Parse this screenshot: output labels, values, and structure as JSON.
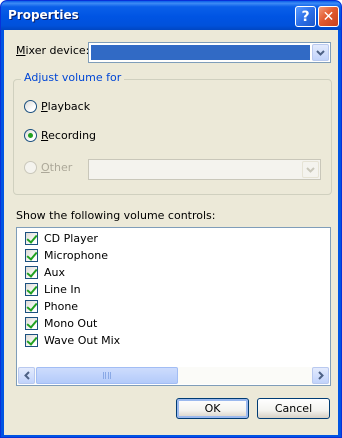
{
  "window": {
    "title": "Properties"
  },
  "titlebar": {
    "help_glyph": "?",
    "close_glyph": "✕"
  },
  "mixer": {
    "label_prefix": "M",
    "label_rest": "ixer device:",
    "selected_value": ""
  },
  "adjust_group": {
    "legend": "Adjust volume for",
    "options": [
      {
        "mnemonic": "P",
        "rest": "layback",
        "checked": false,
        "enabled": true
      },
      {
        "mnemonic": "R",
        "rest": "ecording",
        "checked": true,
        "enabled": true
      },
      {
        "mnemonic": "O",
        "rest": "ther",
        "checked": false,
        "enabled": false
      }
    ],
    "other_select_value": ""
  },
  "controls": {
    "label": "Show the following volume controls:",
    "items": [
      {
        "label": "CD Player",
        "checked": true
      },
      {
        "label": "Microphone",
        "checked": true
      },
      {
        "label": "Aux",
        "checked": true
      },
      {
        "label": "Line In",
        "checked": true
      },
      {
        "label": "Phone",
        "checked": true
      },
      {
        "label": "Mono Out",
        "checked": true
      },
      {
        "label": "Wave Out Mix",
        "checked": true
      }
    ]
  },
  "buttons": {
    "ok": "OK",
    "cancel": "Cancel"
  },
  "colors": {
    "titlebar": "#0054e3",
    "face": "#ece9d8",
    "accent_check": "#21a121",
    "selection": "#316ac5"
  }
}
